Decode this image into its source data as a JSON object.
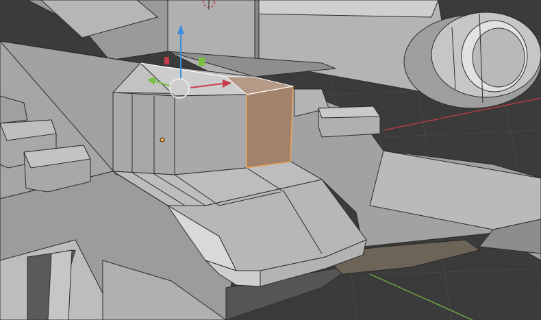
{
  "editor": {
    "type": "3D Viewport",
    "mode": "Edit Mode",
    "selection": "face",
    "colors": {
      "background": "#3d3d3d",
      "mesh": "#a9a9a9",
      "selected_face": "#a3826b",
      "selected_edge": "#ffa94d",
      "axis_x": "#c93a4a",
      "axis_y": "#7ac143",
      "axis_z": "#3a8ce0"
    },
    "gizmo": {
      "type": "move",
      "axes": [
        "x",
        "y",
        "z"
      ],
      "planes": [
        "xy",
        "xz",
        "yz"
      ],
      "icons": [
        "move-gizmo-center-icon",
        "arrow-x-icon",
        "arrow-y-icon",
        "arrow-z-icon"
      ]
    },
    "objects": [
      "tank-hull",
      "turret",
      "cannon-barrel",
      "turret-hatch",
      "side-boxes"
    ]
  }
}
